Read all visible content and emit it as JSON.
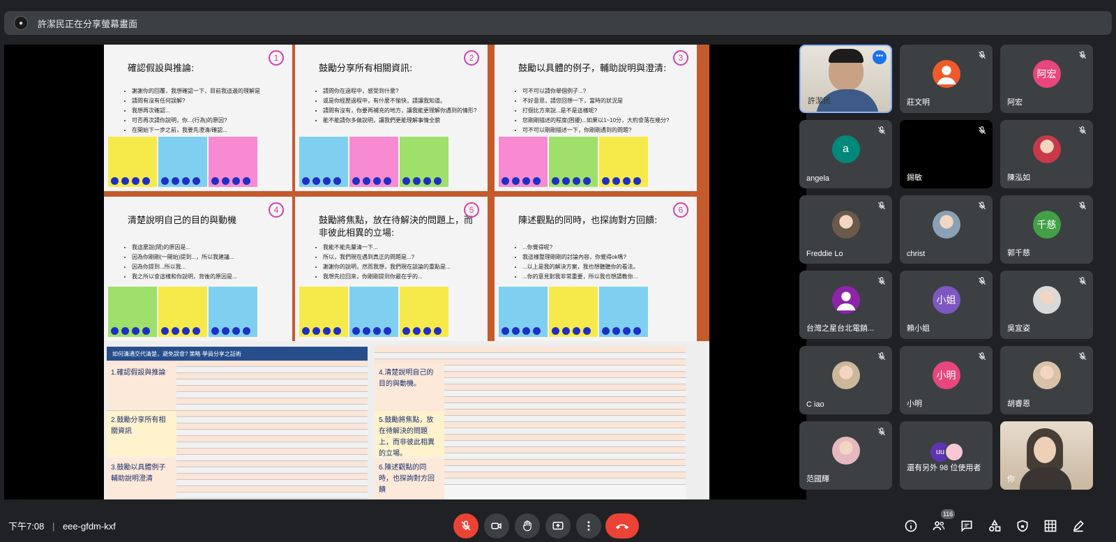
{
  "banner": {
    "text": "許潔民正在分享螢幕畫面"
  },
  "slide": {
    "panels": [
      {
        "title": "確認假設與推論:",
        "num": "1",
        "lines": [
          "謝謝你的回覆，我想確認一下，目前我這邊的理解是",
          "請問有沒有任何誤解?",
          "我想再次確認...",
          "可否再次請你說明，你...(行為)的原因?",
          "在開始下一步之前，我要先澄清/確認..."
        ]
      },
      {
        "title": "鼓勵分享所有相關資訊:",
        "num": "2",
        "lines": [
          "請問你在過程中，感受到什麼?",
          "或是你經歷過程中，有什麼不愉快，請讓我知道。",
          "請問有沒有，你要再補充的地方，讓我能更理解你遇到的情形?",
          "能不能請你多做說明，讓我們更能理解事情全貌"
        ]
      },
      {
        "title": "鼓勵以具體的例子，輔助說明與澄清:",
        "num": "3",
        "lines": [
          "可不可以請你舉個例子...?",
          "不好意思，請您回想一下，當時的狀況是",
          "打個比方來說...是不是這樣呢?",
          "您剛剛描述的程度(困擾)...如果以1~10分，大約會落在幾分?",
          "可不可以剛剛描述一下，你剛剛遇到的問題?"
        ]
      },
      {
        "title": "清楚說明自己的目的與動機",
        "num": "4",
        "lines": [
          "我這麼說(問)的原因是...",
          "因為你剛剛(一開始)提到...，所以我建議...",
          "因為你提到...所以我...",
          "我之所以會這樣和你說明，背後的原因是..."
        ]
      },
      {
        "title": "鼓勵將焦點，放在待解決的問題上，而非彼此相異的立場:",
        "num": "5",
        "lines": [
          "我能不能先釐清一下...",
          "所以，我們現在遇到真正的問題是...?",
          "謝謝你的說明，然而我想，我們現在談論的重點是...",
          "我想先拉回來，你剛剛提到你最在乎的..."
        ]
      },
      {
        "title": "陳述觀點的同時，也探詢對方回饋:",
        "num": "6",
        "lines": [
          "...你覺得呢?",
          "我這樣整理剛剛的討論內容，你覺得ok嗎?",
          "...以上是我的解決方案，我也想聽聽你的看法。",
          "...你的意見對我非常重要，所以我也想請教你..."
        ]
      }
    ],
    "sheet": {
      "left_header": "如何溝通交代清楚，避免誤會?    策略  學員分享之話術",
      "left_cats": [
        "1.確認假設與推論",
        "2.鼓勵分享所有相關資訊",
        "3.鼓勵以具體例子輔助說明澄清"
      ],
      "right_cats": [
        "4.清楚說明自己的目的與動機。",
        "5.鼓勵將焦點，放在待解決的問題上，而非彼此相異的立場。",
        "6.陳述觀點的同時，也探詢對方回饋"
      ]
    }
  },
  "tiles": [
    {
      "name": "許潔民",
      "type": "video",
      "active": true
    },
    {
      "name": "莊文明",
      "type": "avatar",
      "color": "#f05a28",
      "letter": ""
    },
    {
      "name": "阿宏",
      "type": "avatar",
      "color": "#e8467c",
      "letter": "阿宏"
    },
    {
      "name": "angela",
      "type": "avatar",
      "color": "#00897b",
      "letter": "a"
    },
    {
      "name": "錫敏",
      "type": "black"
    },
    {
      "name": "陳泓如",
      "type": "photo",
      "color": "#c9394a"
    },
    {
      "name": "Freddie Lo",
      "type": "photo",
      "color": "#6b5a4a"
    },
    {
      "name": "christ",
      "type": "photo",
      "color": "#8aa0b4"
    },
    {
      "name": "郭千慈",
      "type": "avatar",
      "color": "#43a047",
      "letter": "千慈"
    },
    {
      "name": "台灣之星台北電銷...",
      "type": "avatar",
      "color": "#8e24aa",
      "letter": ""
    },
    {
      "name": "賴小姐",
      "type": "avatar",
      "color": "#7e57c2",
      "letter": "小姐"
    },
    {
      "name": "吳宜姿",
      "type": "photo",
      "color": "#d9d9d9"
    },
    {
      "name": "C iao",
      "type": "photo",
      "color": "#cbb89a"
    },
    {
      "name": "小明",
      "type": "avatar",
      "color": "#e8467c",
      "letter": "小明"
    },
    {
      "name": "胡睿恩",
      "type": "photo",
      "color": "#d8c3a8"
    },
    {
      "name": "范國輝",
      "type": "photo",
      "color": "#e6b8c0"
    },
    {
      "name": "還有另外 98 位使用者",
      "type": "others"
    },
    {
      "name": "你",
      "type": "self"
    }
  ],
  "bottom": {
    "time": "下午7:08",
    "separator": "|",
    "meeting_code": "eee-gfdm-kxf",
    "participant_count": "116"
  }
}
